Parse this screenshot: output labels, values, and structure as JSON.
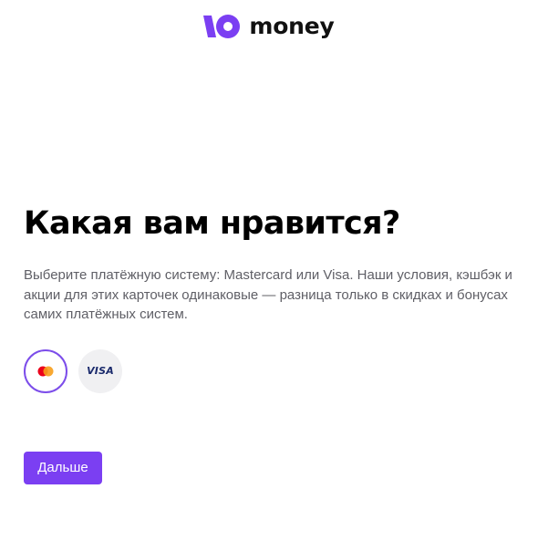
{
  "header": {
    "logo_text": "money"
  },
  "main": {
    "title": "Какая вам нравится?",
    "description": "Выберите платёжную систему: Mastercard или Visa. Наши условия, кэшбэк и акции для этих карточек одинаковые — разница только в скидках и бонусах самих платёжных систем.",
    "card_options": [
      {
        "icon": "mastercard-icon",
        "selected": true
      },
      {
        "icon": "visa-icon",
        "label": "VISA",
        "selected": false
      }
    ],
    "next_button_label": "Дальше"
  },
  "colors": {
    "brand_purple": "#7b3ff2",
    "selected_border": "#7c4dea",
    "mastercard_red": "#eb001b",
    "mastercard_orange": "#f79e1b",
    "visa_blue": "#1a2a6c",
    "description_gray": "#5f5f66"
  }
}
